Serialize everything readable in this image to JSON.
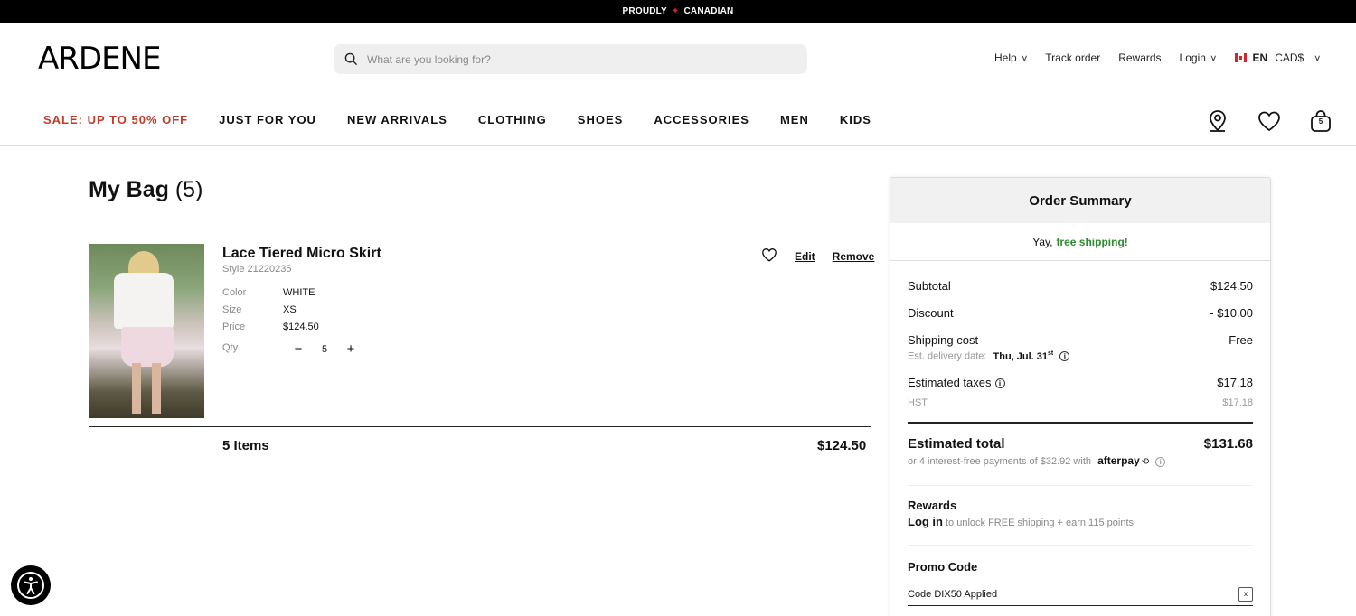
{
  "topbar": {
    "left": "PROUDLY",
    "right": "CANADIAN"
  },
  "header": {
    "logo": "ARDENE",
    "search_placeholder": "What are you looking for?",
    "utility": {
      "help": "Help",
      "track": "Track order",
      "rewards": "Rewards",
      "login": "Login",
      "lang": "EN",
      "currency": "CAD$"
    }
  },
  "nav": {
    "items": [
      "SALE: UP TO 50% OFF",
      "JUST FOR YOU",
      "NEW ARRIVALS",
      "CLOTHING",
      "SHOES",
      "ACCESSORIES",
      "MEN",
      "KIDS"
    ],
    "bag_count": "5"
  },
  "bag": {
    "title": "My Bag",
    "count": "(5)",
    "product": {
      "name": "Lace Tiered Micro Skirt",
      "style": "Style 21220235",
      "color_label": "Color",
      "color": "WHITE",
      "size_label": "Size",
      "size": "XS",
      "price_label": "Price",
      "price": "$124.50",
      "qty_label": "Qty",
      "qty": "5",
      "edit": "Edit",
      "remove": "Remove"
    },
    "items_label": "5 Items",
    "items_total": "$124.50"
  },
  "summary": {
    "title": "Order Summary",
    "shipping_msg": "Yay,",
    "shipping_free": "free shipping!",
    "subtotal_label": "Subtotal",
    "subtotal": "$124.50",
    "discount_label": "Discount",
    "discount": "- $10.00",
    "shipping_label": "Shipping cost",
    "shipping": "Free",
    "delivery_label": "Est. delivery date:",
    "delivery_date": "Thu, Jul. 31",
    "delivery_sup": "st",
    "taxes_label": "Estimated taxes",
    "taxes": "$17.18",
    "hst_label": "HST",
    "hst": "$17.18",
    "total_label": "Estimated total",
    "total": "$131.68",
    "afterpay_text": "or 4 interest-free payments of $32.92 with",
    "afterpay_brand": "afterpay",
    "rewards_label": "Rewards",
    "rewards_login": "Log in",
    "rewards_text": "to unlock FREE shipping + earn 115 points",
    "promo_label": "Promo Code",
    "promo_value": "Code DIX50 Applied",
    "promo_clear": "x"
  },
  "colors": {
    "sale": "#c0392b",
    "free": "#2e8b2e",
    "flag": "#d8232a"
  }
}
